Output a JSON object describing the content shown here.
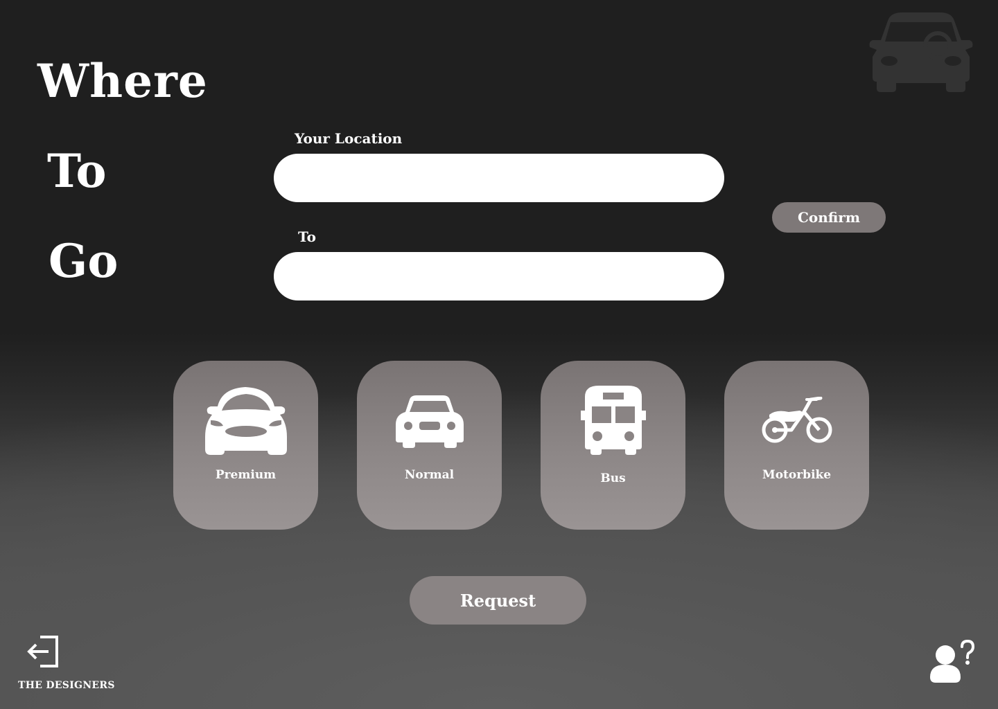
{
  "hero": {
    "line1": "Where",
    "line2": "To",
    "line3": "Go"
  },
  "form": {
    "from_label": "Your Location",
    "from_value": "",
    "to_label": "To",
    "to_value": "",
    "confirm_label": "Confirm"
  },
  "vehicles": [
    {
      "label": "Premium",
      "icon": "premium-car-icon"
    },
    {
      "label": "Normal",
      "icon": "car-icon"
    },
    {
      "label": "Bus",
      "icon": "bus-icon"
    },
    {
      "label": "Motorbike",
      "icon": "motorbike-icon"
    }
  ],
  "request_label": "Request",
  "footer": {
    "brand": "THE DESIGNERS",
    "exit_icon": "exit-icon",
    "help_icon": "user-help-icon"
  },
  "colors": {
    "background": "#1f1f1f",
    "card": "#8d8787",
    "pill": "#7e7878",
    "field": "#ffffff"
  }
}
